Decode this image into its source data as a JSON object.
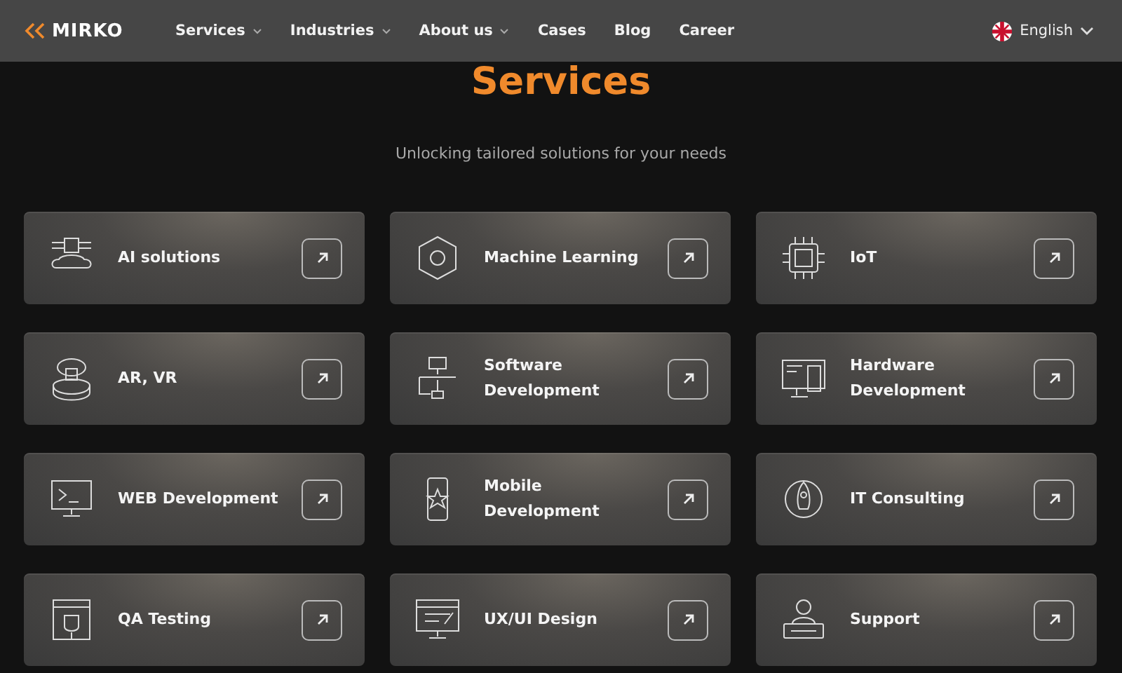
{
  "header": {
    "logo": "MIRKO",
    "nav": [
      {
        "label": "Services",
        "has_menu": true
      },
      {
        "label": "Industries",
        "has_menu": true
      },
      {
        "label": "About us",
        "has_menu": true
      },
      {
        "label": "Cases",
        "has_menu": false
      },
      {
        "label": "Blog",
        "has_menu": false
      },
      {
        "label": "Career",
        "has_menu": false
      }
    ],
    "language": "English"
  },
  "section": {
    "title": "Services",
    "subtitle": "Unlocking tailored solutions for your needs"
  },
  "services": [
    {
      "label": "AI solutions"
    },
    {
      "label": "Machine Learning"
    },
    {
      "label": "IoT"
    },
    {
      "label": "AR, VR"
    },
    {
      "label": "Software Development"
    },
    {
      "label": "Hardware Development"
    },
    {
      "label": "WEB Development"
    },
    {
      "label": "Mobile Development"
    },
    {
      "label": "IT Consulting"
    },
    {
      "label": "QA Testing"
    },
    {
      "label": "UX/UI Design"
    },
    {
      "label": "Support"
    }
  ]
}
